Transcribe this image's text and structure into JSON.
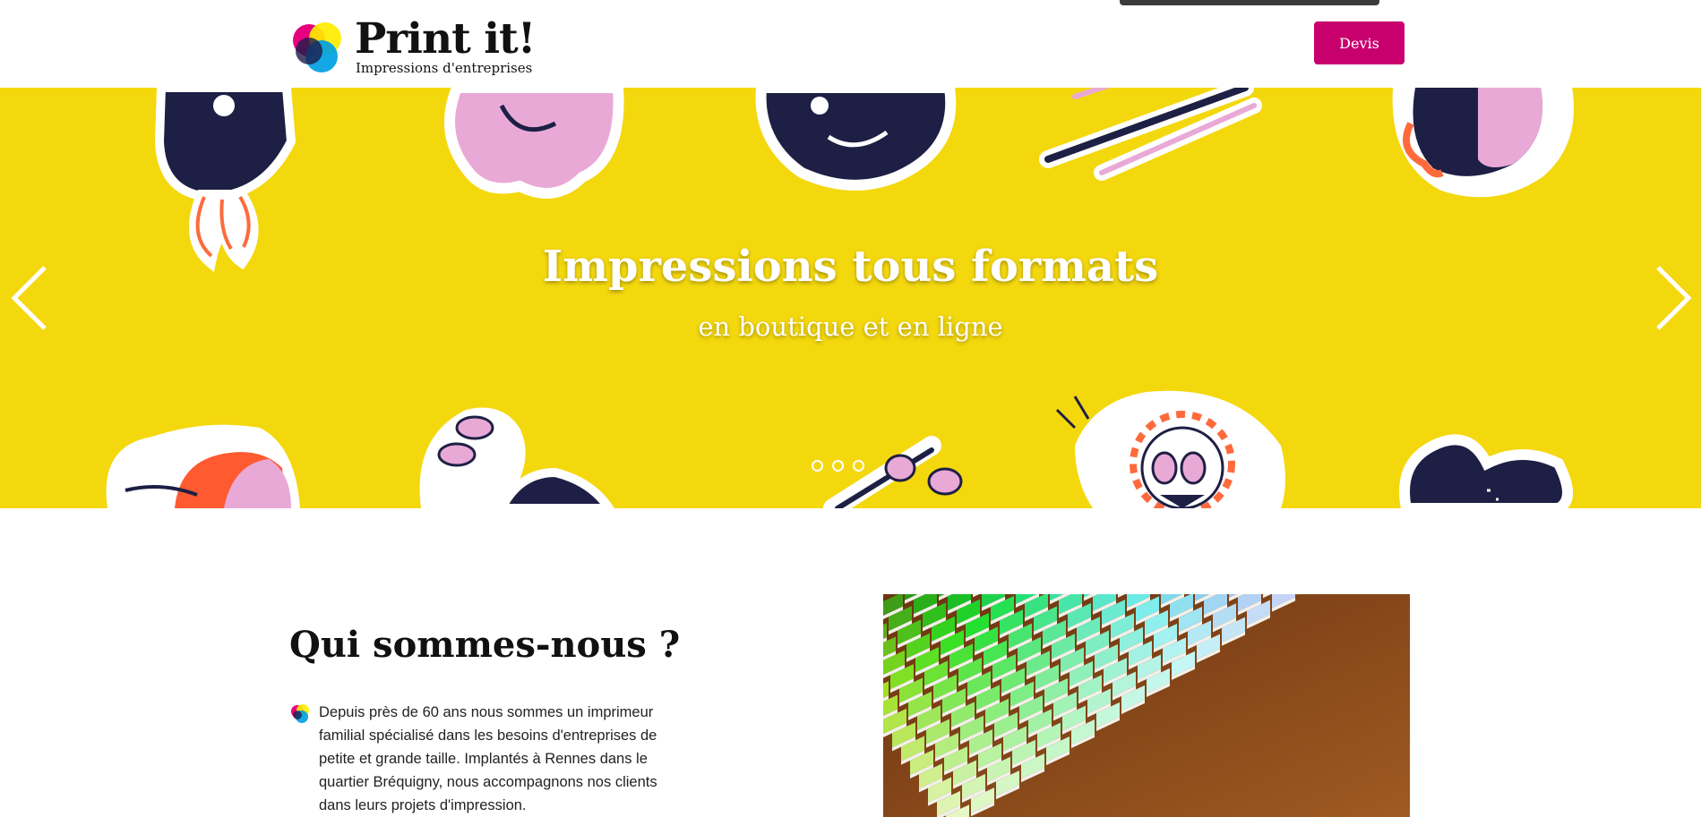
{
  "header": {
    "brand": "Print it!",
    "tagline": "Impressions d'entreprises",
    "cta_label": "Devis"
  },
  "hero": {
    "title": "Impressions tous formats",
    "subtitle": "en boutique et en ligne",
    "slide_count": 3,
    "background_color": "#f4d80e"
  },
  "about": {
    "title": "Qui sommes-nous ?",
    "text": "Depuis près de 60 ans nous sommes un imprimeur familial spécialisé dans les besoins d'entreprises de petite et grande taille. Implantés à Rennes dans le quartier Bréquigny, nous accompagnons nos clients dans leurs projets d'impression."
  },
  "colors": {
    "accent": "#c8006e",
    "hero_yellow": "#f4d80e",
    "logo_magenta": "#e6007e",
    "logo_yellow": "#ffed00",
    "logo_cyan": "#009fe3"
  },
  "icons": [
    "logo-mark-icon",
    "chevron-left-icon",
    "chevron-right-icon",
    "bullet-logo-icon"
  ]
}
